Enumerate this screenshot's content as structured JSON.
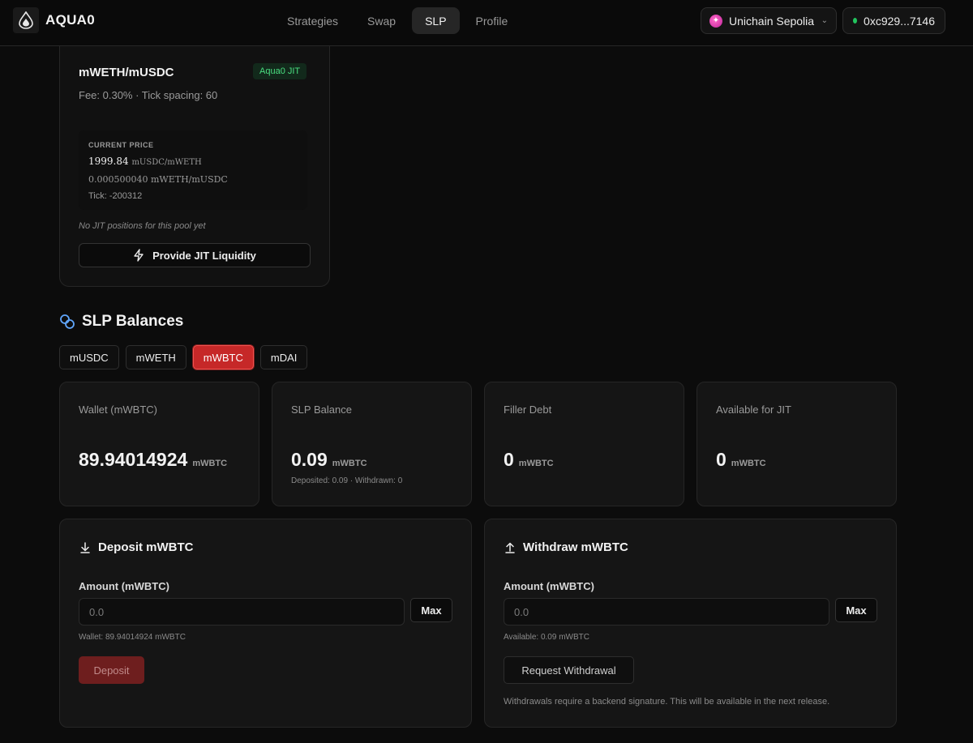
{
  "header": {
    "brand": "AQUA0",
    "nav": [
      {
        "label": "Strategies",
        "active": false
      },
      {
        "label": "Swap",
        "active": false
      },
      {
        "label": "SLP",
        "active": true
      },
      {
        "label": "Profile",
        "active": false
      }
    ],
    "chain": "Unichain Sepolia",
    "wallet": "0xc929...7146"
  },
  "pool": {
    "title": "mWETH/mUSDC",
    "badge": "Aqua0 JIT",
    "meta": "Fee: 0.30% · Tick spacing: 60",
    "price_label": "CURRENT PRICE",
    "price_value": "1999.84",
    "price_unit": "mUSDC/mWETH",
    "inverse_price": "0.000500040 mWETH/mUSDC",
    "tick": "Tick: -200312",
    "no_positions": "No JIT positions for this pool yet",
    "jit_button": "Provide JIT Liquidity"
  },
  "slp": {
    "title": "SLP Balances",
    "tokens": [
      "mUSDC",
      "mWETH",
      "mWBTC",
      "mDAI"
    ],
    "active_token": "mWBTC",
    "stats": [
      {
        "label": "Wallet (mWBTC)",
        "value": "89.94014924",
        "unit": "mWBTC",
        "note": ""
      },
      {
        "label": "SLP Balance",
        "value": "0.09",
        "unit": "mWBTC",
        "note": "Deposited: 0.09 · Withdrawn: 0"
      },
      {
        "label": "Filler Debt",
        "value": "0",
        "unit": "mWBTC",
        "note": ""
      },
      {
        "label": "Available for JIT",
        "value": "0",
        "unit": "mWBTC",
        "note": ""
      }
    ]
  },
  "deposit": {
    "title": "Deposit mWBTC",
    "field_label": "Amount (mWBTC)",
    "placeholder": "0.0",
    "max_label": "Max",
    "help": "Wallet: 89.94014924 mWBTC",
    "button": "Deposit"
  },
  "withdraw": {
    "title": "Withdraw mWBTC",
    "field_label": "Amount (mWBTC)",
    "placeholder": "0.0",
    "max_label": "Max",
    "help": "Available: 0.09 mWBTC",
    "button": "Request Withdrawal",
    "note": "Withdrawals require a backend signature. This will be available in the next release."
  },
  "colors": {
    "accent_red": "#c62828",
    "badge_green": "#4ade80",
    "status_green": "#22c55e"
  }
}
